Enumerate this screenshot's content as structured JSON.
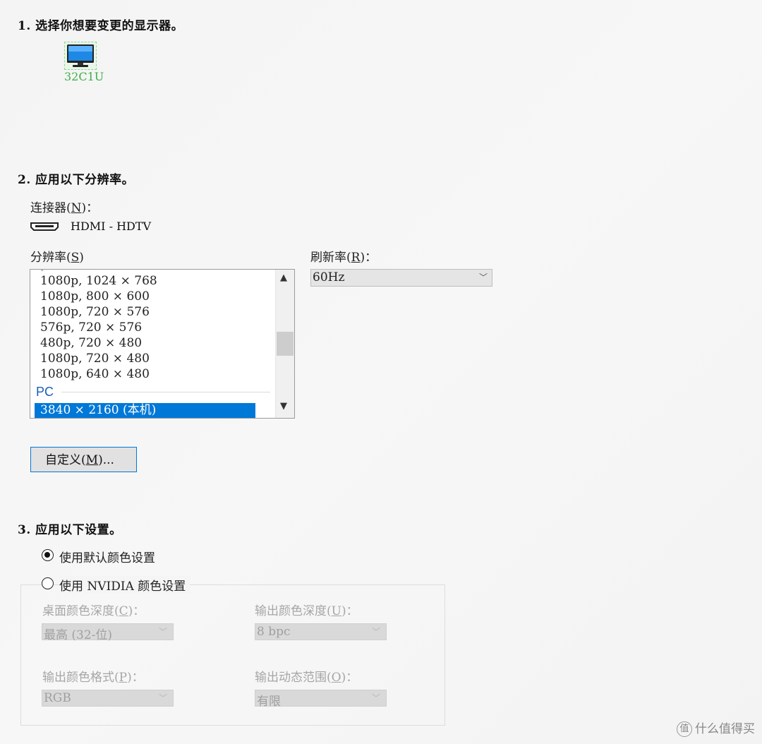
{
  "step1": {
    "title": "1. 选择你想要变更的显示器。",
    "monitor_name": "32C1U"
  },
  "step2": {
    "title": "2. 应用以下分辨率。",
    "connector_label": "连接器",
    "connector_hotkey": "N",
    "connector_value": "HDMI - HDTV",
    "resolution_label": "分辨率",
    "resolution_hotkey": "S",
    "refresh_label": "刷新率",
    "refresh_hotkey": "R",
    "refresh_value": "60Hz",
    "resolutions": [
      "1080p, 1024 × 768",
      "1080p, 800 × 600",
      "1080p, 720 × 576",
      "576p, 720 × 576",
      "480p, 720 × 480",
      "1080p, 720 × 480",
      "1080p, 640 × 480"
    ],
    "pc_header": "PC",
    "selected_resolution": "3840 × 2160 (本机)",
    "custom_button": "自定义",
    "custom_hotkey": "M"
  },
  "step3": {
    "title": "3. 应用以下设置。",
    "radio_default": "使用默认颜色设置",
    "radio_nvidia": "使用 NVIDIA 颜色设置",
    "radio_default_selected": true,
    "desktop_depth_label": "桌面颜色深度",
    "desktop_depth_hotkey": "C",
    "desktop_depth_value": "最高 (32-位)",
    "output_depth_label": "输出颜色深度",
    "output_depth_hotkey": "U",
    "output_depth_value": "8 bpc",
    "output_format_label": "输出颜色格式",
    "output_format_hotkey": "P",
    "output_format_value": "RGB",
    "dynamic_range_label": "输出动态范围",
    "dynamic_range_hotkey": "O",
    "dynamic_range_value": "有限"
  },
  "watermark": {
    "logo": "值",
    "text": "什么值得买"
  },
  "colors": {
    "selection": "#0078d7",
    "monitor_name": "#3cb043",
    "pc_header": "#1a5fb4"
  },
  "icons": [
    "monitor-icon",
    "hdmi-icon",
    "chevron-up-icon",
    "chevron-down-icon",
    "radio-icon"
  ]
}
